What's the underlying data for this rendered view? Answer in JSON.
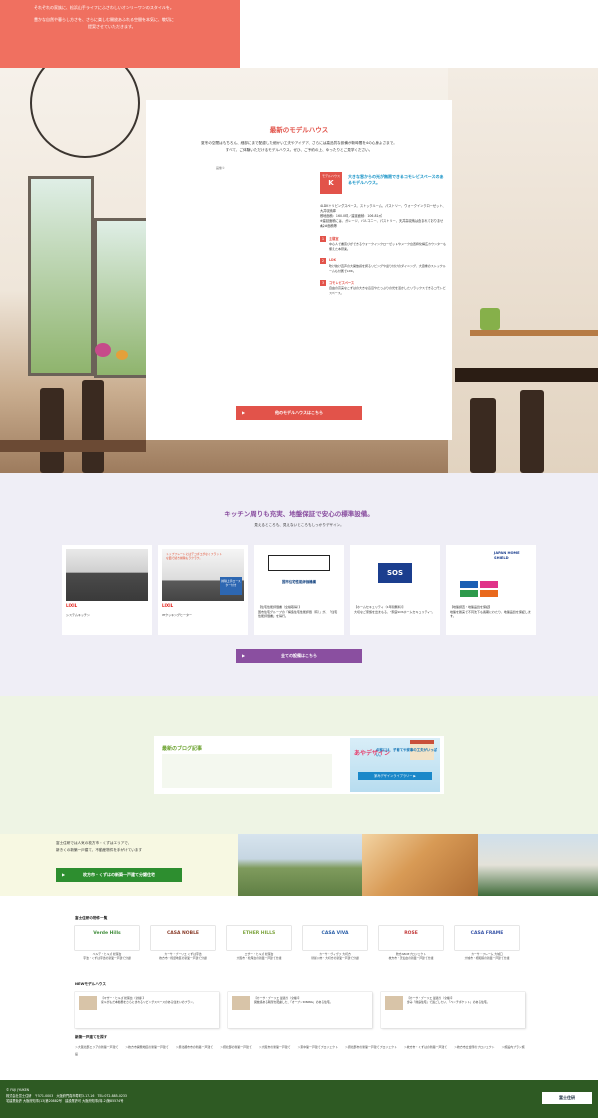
{
  "intro": {
    "lines": [
      "それぞれの家族に、松浜山手ライフにふさわしいオンリーワンのスタイルを。",
      "豊かな自然や暮らし方さを、さらに楽しむ開放あふれる空間を本気に、敬切に",
      "提案させていただきます。"
    ]
  },
  "model_house": {
    "title": "最新のモデルハウス",
    "intro_lines": [
      "夏冬の空間はもちろん、細部にまで配慮した細かい工夫やアイデア、さらには高品質な設備が新時間を4の心身よさまで。",
      "すべて、ご体験いただけるモデルハウス。ぜひ、ご予約の上、ゆったりとご見学ください。"
    ],
    "image_alt": "画像①",
    "badge_label": "モデルハウス",
    "badge_letter": "K",
    "catch": "大きな窓からの光が無限できるコモレビスペースのあるモデルハウス。",
    "spec_lines": [
      "4LDK＋リビングスペース、ストックルーム、パストリー、ウォークインクローゼット、大井収納庫",
      "敷地面積：160.0坪／建延面積：106.81㎡",
      "※建延面積には、ガレージ、バルコニー、パストリー、天井高収納は含まれておりません。",
      "※2#面積等"
    ],
    "points": [
      {
        "num": "1",
        "title": "主寝室",
        "desc": "中心人で書斎びができるウォークインクローゼットやメーク台置枠化構広カウンターも備えた本寝楽。"
      },
      {
        "num": "2",
        "title": "LDK",
        "desc": "吹け抜け直声の大開放感を誇るリビングや迎り付けのダイニング、大迫重のストックルームも付属でLDK。"
      },
      {
        "num": "3",
        "title": "コモレビスペース",
        "desc": "自由の高実なこずはの大きな窓辺やたっぷりの光を活かしたリラックスできるコモレビスペース。"
      }
    ],
    "button": "他のモデルハウスはこちら"
  },
  "equipment": {
    "title": "キッチン周りも充実、地盤保証で安心の標準設備。",
    "subtitle": "見えるところも、見えないところもしっかりデザイン。",
    "cards": [
      {
        "brand": "LIXIL",
        "caption": "システムキッチン"
      },
      {
        "brand": "LIXIL",
        "caption": "IHクッキングヒーター",
        "overlay": "トップフレートにはデコボコがなくフラットな面で拭き掃除もラクラク。",
        "tag": "掃除上手ロースター付き"
      },
      {
        "brand": "",
        "caption": "【住宅性能評価書（全棟取得）】\n国市住宅グループの「構造住宅性能評価（有）」が、「住宅性能評価書」を得行。",
        "org": "国市住宅性能評価機構"
      },
      {
        "brand": "SOS",
        "caption": "【ホームセキュリティ（1年間無料）】\n大切なご家族を出まもる、\"家庭SOSホームセキュリティ\"。"
      },
      {
        "brand": "JAPAN HOME SHIELD",
        "caption": "【地盤調査・地盤品質を保証】\n地盤を確実で不同沈下も長期にわたり、地盤品質を保証します。"
      }
    ],
    "button": "全ての設備はこちら"
  },
  "blog": {
    "title": "最新のブログ記事",
    "banner_logo": "あやデザイン",
    "banner_text": "の家には、子育てや家事の工夫がいっぱい。",
    "banner_button": "家みデザインライブラリー ▶"
  },
  "area": {
    "lines": [
      "富士住研では人気の枚方市・くずはエリアで、",
      "新きくの新築一戸建て、不動産物件を手がけています"
    ],
    "button": "枚方市・くずはの新築一戸建て分譲住宅"
  },
  "properties": {
    "heading": "富士住研の物件一覧",
    "items": [
      {
        "logo": "Verde Hills",
        "color": "#3f8c3a",
        "text": "ベルデ・ヒルズ 松尾台\n宇治・くずは宇治の新築一戸建て分譲"
      },
      {
        "logo": "CASA NOBLE",
        "color": "#8a3d2a",
        "text": "カーサ・ブーリエ くずは宇治\n枚方市・樟葉地区の新築一戸建て分譲"
      },
      {
        "logo": "ETHER HILLS",
        "color": "#7aa23a",
        "text": "エザー・ヒルズ 松尾台\n大阪市・松尾台の新築一戸建て分譲"
      },
      {
        "logo": "CASA VIVA",
        "color": "#2a5fa8",
        "text": "カーサ・ヴィヴァ 大町方\n寝屋川市・大町方の新築一戸建て分譲"
      },
      {
        "logo": "ROSE",
        "color": "#c23a3a",
        "text": "牧方ABCBプロジェクト\n枚方市・天仙台の新築一戸建て分譲"
      },
      {
        "logo": "CASA FRAME",
        "color": "#3a56a8",
        "text": "カーサ・フレーム 大城口\n大城市・相和院の新築一戸建て分譲"
      }
    ],
    "new_heading": "NEWモデルハウス",
    "new_items": [
      "【マザー・ヒルズ 松尾台（全棟）】\n家ルがもだ本動務をさらにまれるリビングスペースのある住まいのプラン。",
      "【カーサ・ブーリエ 最適り（全棟）】\n開放感ある眺望を配慮した、「オープンDINING」のある住宅。",
      "【カーサ・ブーリエ 最適り（全棟）】\n歩み「前庭住宅」で過ごしたい、「ベンチポケット」のある住宅。"
    ],
    "search_heading": "新築一戸建てを探す",
    "tags": [
      "＞大阪北部エリアの新築一戸建て",
      "＞枚方市開発地区の新築一戸建て",
      "＞摂北都市市の新築一戸建て",
      "＞摂北部の新築一戸建て",
      "＞大阪市の新築一戸建て",
      "＞東中築一戸建てプロジェクト",
      "＞摂北部市の新築一戸建てプロジェクト",
      "＞枚方市・くずはの新築一戸建て",
      "＞枚方市立合所のプロジェクト",
      "＞施設内プラン施設"
    ]
  },
  "footer": {
    "lines": [
      "© FUJI JYUKEN",
      "株式会社富士住研　〒571-0003　大阪府門真市寿町3-17-16　TEL:072-885-0233",
      "宅建業免許 大阪府知事(13)第20882号　建設業許可 大阪府知事(特-2)第85574号"
    ],
    "logo": "富士住研"
  }
}
